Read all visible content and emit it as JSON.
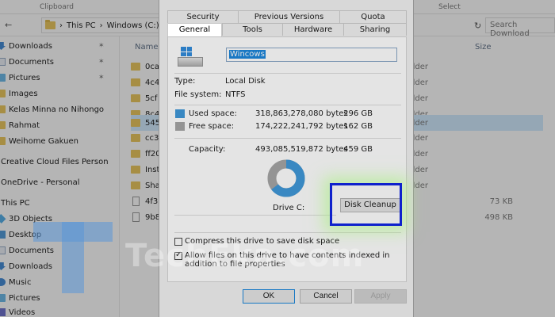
{
  "ribbon": {
    "left_label": "Clipboard",
    "right_label": "Select"
  },
  "address": {
    "path": [
      "This PC",
      "Windows (C:)"
    ],
    "search_placeholder": "Search Download"
  },
  "nav": {
    "items": [
      {
        "label": "Downloads",
        "icon": "downloads-icon",
        "pinned": true
      },
      {
        "label": "Documents",
        "icon": "documents-icon",
        "pinned": true
      },
      {
        "label": "Pictures",
        "icon": "pictures-icon",
        "pinned": true
      },
      {
        "label": "Images",
        "icon": "folder-icon"
      },
      {
        "label": "Kelas Minna no Nihongo",
        "icon": "folder-icon"
      },
      {
        "label": "Rahmat",
        "icon": "folder-icon"
      },
      {
        "label": "Weihome Gakuen",
        "icon": "folder-icon"
      },
      {
        "label": "Creative Cloud Files Personal A",
        "icon": "creative-cloud-icon"
      },
      {
        "label": "OneDrive - Personal",
        "icon": "onedrive-icon"
      },
      {
        "label": "This PC",
        "icon": "this-pc-icon"
      },
      {
        "label": "3D Objects",
        "icon": "3d-objects-icon"
      },
      {
        "label": "Desktop",
        "icon": "desktop-icon"
      },
      {
        "label": "Documents",
        "icon": "documents-icon"
      },
      {
        "label": "Downloads",
        "icon": "downloads-icon"
      },
      {
        "label": "Music",
        "icon": "music-icon"
      },
      {
        "label": "Pictures",
        "icon": "pictures-icon"
      },
      {
        "label": "Videos",
        "icon": "videos-icon"
      }
    ]
  },
  "content": {
    "col_name": "Name",
    "col_size": "Size",
    "files": [
      {
        "name": "0ca",
        "type": "folder",
        "size": ""
      },
      {
        "name": "4c4",
        "type": "folder",
        "size": ""
      },
      {
        "name": "5cf",
        "type": "folder",
        "size": ""
      },
      {
        "name": "8c4",
        "type": "folder",
        "size": ""
      },
      {
        "name": "545",
        "type": "folder",
        "size": ""
      },
      {
        "name": "cc3",
        "type": "folder",
        "size": ""
      },
      {
        "name": "ff20",
        "type": "folder",
        "size": ""
      },
      {
        "name": "Inst",
        "type": "folder",
        "size": ""
      },
      {
        "name": "Sha",
        "type": "folder",
        "size": ""
      },
      {
        "name": "4f3",
        "type": "",
        "size": "73 KB"
      },
      {
        "name": "9b8",
        "type": "",
        "size": "498 KB"
      }
    ],
    "type_label": "folder"
  },
  "dialog": {
    "tabs_row1": [
      "Security",
      "Previous Versions",
      "Quota"
    ],
    "tabs_row2": [
      "General",
      "Tools",
      "Hardware",
      "Sharing"
    ],
    "active_tab": "General",
    "drive_name": "Wincows",
    "type_label": "Type:",
    "type_value": "Local Disk",
    "fs_label": "File system:",
    "fs_value": "NTFS",
    "used_label": "Used space:",
    "used_bytes": "318,863,278,080 bytes",
    "used_gb": "296 GB",
    "free_label": "Free space:",
    "free_bytes": "174,222,241,792 bytes",
    "free_gb": "162 GB",
    "capacity_label": "Capacity:",
    "capacity_bytes": "493,085,519,872 bytes",
    "capacity_gb": "459 GB",
    "used_fraction": 0.6467,
    "drive_label": "Drive C:",
    "cleanup_label": "Disk Cleanup",
    "compress_label": "Compress this drive to save disk space",
    "compress_checked": false,
    "index_label": "Allow files on this drive to have contents indexed in addition to file properties",
    "index_checked": true,
    "ok_label": "OK",
    "cancel_label": "Cancel",
    "apply_label": "Apply",
    "colors": {
      "used": "#2a8dd5",
      "free": "#9c9c9c",
      "highlight": "#0f21cc"
    }
  },
  "watermark": {
    "text": "TechEka.com"
  }
}
